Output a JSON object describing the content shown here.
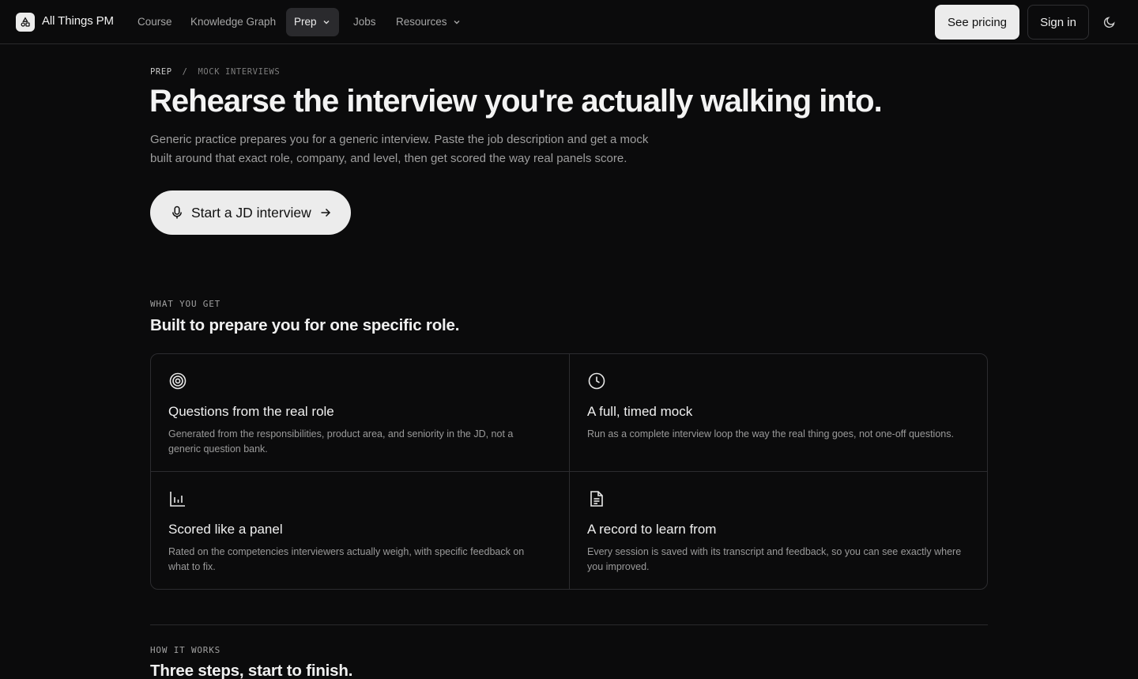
{
  "nav": {
    "brand": "All Things PM",
    "links": [
      {
        "label": "Course"
      },
      {
        "label": "Knowledge Graph"
      },
      {
        "label": "Prep"
      },
      {
        "label": "Jobs"
      },
      {
        "label": "Resources"
      }
    ],
    "pricing_label": "See pricing",
    "signin_label": "Sign in"
  },
  "breadcrumb": {
    "section": "PREP",
    "separator": "/",
    "current": "MOCK INTERVIEWS"
  },
  "hero": {
    "title": "Rehearse the interview you're actually walking into.",
    "subtitle": "Generic practice prepares you for a generic interview. Paste the job description and get a mock built around that exact role, company, and level, then get scored the way real panels score.",
    "cta_label": "Start a JD interview"
  },
  "features": {
    "eyebrow": "WHAT YOU GET",
    "title": "Built to prepare you for one specific role.",
    "items": [
      {
        "icon": "target-icon",
        "title": "Questions from the real role",
        "body": "Generated from the responsibilities, product area, and seniority in the JD, not a generic question bank."
      },
      {
        "icon": "clock-icon",
        "title": "A full, timed mock",
        "body": "Run as a complete interview loop the way the real thing goes, not one-off questions."
      },
      {
        "icon": "bar-chart-icon",
        "title": "Scored like a panel",
        "body": "Rated on the competencies interviewers actually weigh, with specific feedback on what to fix."
      },
      {
        "icon": "document-icon",
        "title": "A record to learn from",
        "body": "Every session is saved with its transcript and feedback, so you can see exactly where you improved."
      }
    ]
  },
  "how_it_works": {
    "eyebrow": "HOW IT WORKS",
    "title": "Three steps, start to finish."
  }
}
